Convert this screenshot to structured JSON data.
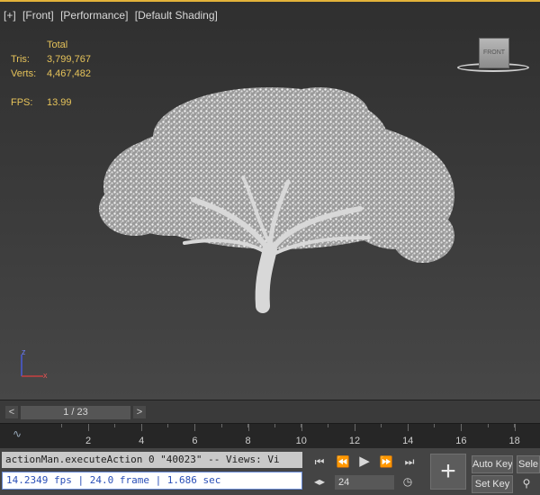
{
  "viewport": {
    "labels": [
      "[+]",
      "[Front]",
      "[Performance]",
      "[Default Shading]"
    ],
    "stats": {
      "header": "Total",
      "tris_label": "Tris:",
      "tris_value": "3,799,767",
      "verts_label": "Verts:",
      "verts_value": "4,467,482",
      "fps_label": "FPS:",
      "fps_value": "13.99"
    },
    "viewcube_label": "FRONT",
    "axis": {
      "z": "z",
      "x": "x"
    }
  },
  "timebar": {
    "prev": "<",
    "next": ">",
    "frame_display": "1 / 23"
  },
  "trackbar": {
    "ticks": [
      "2",
      "4",
      "6",
      "8",
      "10",
      "12",
      "14",
      "16",
      "18"
    ]
  },
  "listener": {
    "script_line": "actionMan.executeAction 0 \"40023\"  -- Views: Vi",
    "status_line": "14.2349 fps | 24.0 frame | 1.686 sec"
  },
  "playback": {
    "frame_value": "24"
  },
  "keys": {
    "auto_key": "Auto Key",
    "set_key": "Set Key",
    "select": "Sele"
  },
  "colors": {
    "accent": "#e2b23a",
    "stats_text": "#e6c35a",
    "status_text": "#2a4fb8"
  }
}
